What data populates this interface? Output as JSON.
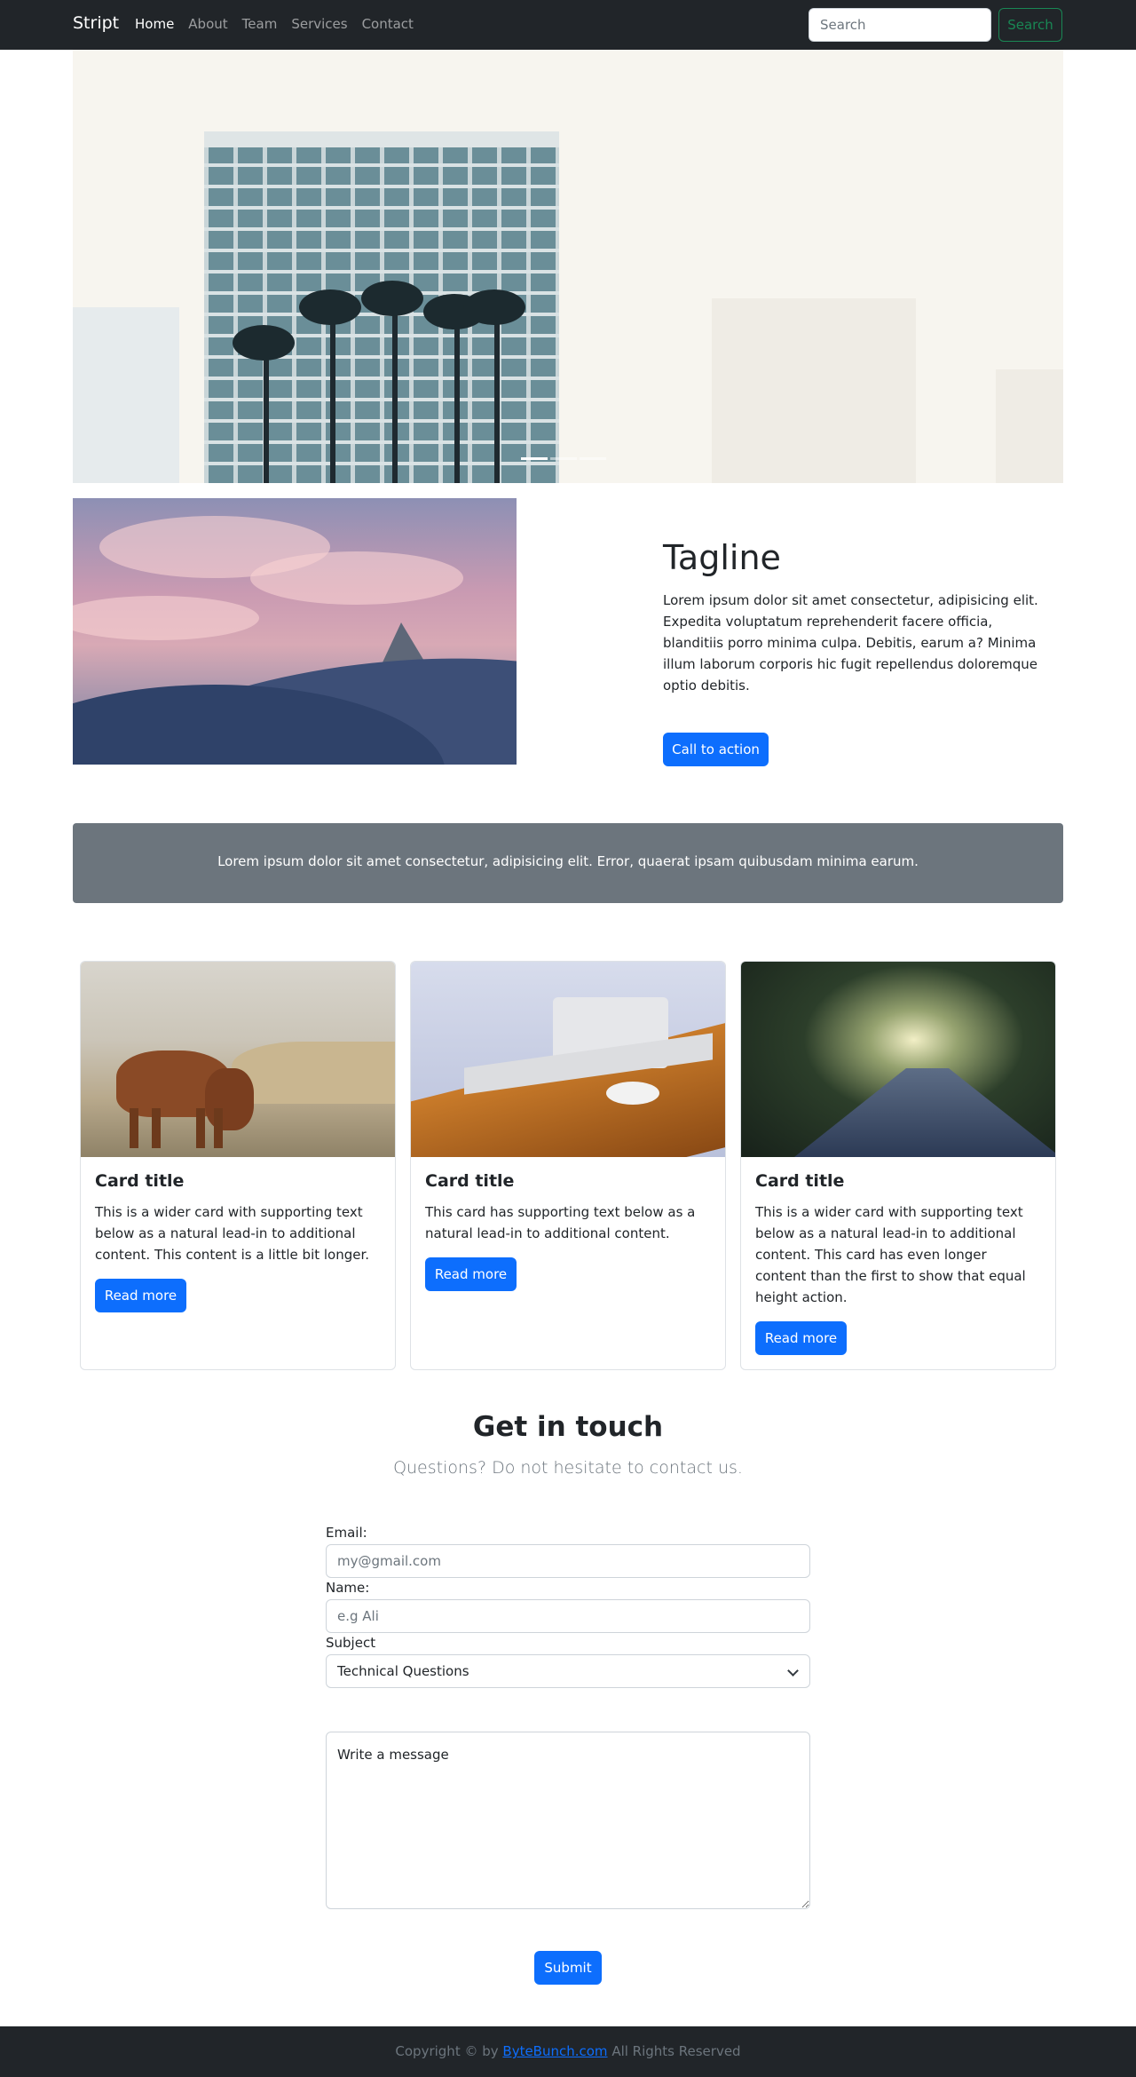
{
  "navbar": {
    "brand": "Stript",
    "links": [
      "Home",
      "About",
      "Team",
      "Services",
      "Contact"
    ],
    "active_link": "Home",
    "search_placeholder": "Search",
    "search_button": "Search"
  },
  "hero": {
    "image": "city-tower-with-palms",
    "indicators": 3,
    "active_indicator": 1
  },
  "feature": {
    "image": "mountain-peak-at-sunset",
    "tagline": "Tagline",
    "text": "Lorem ipsum dolor sit amet consectetur, adipisicing elit. Expedita voluptatum reprehenderit facere officia, blanditiis porro minima culpa. Debitis, earum a? Minima illum laborum corporis hic fugit repellendus doloremque optio debitis.",
    "cta_label": "Call to action"
  },
  "banner": {
    "text": "Lorem ipsum dolor sit amet consectetur, adipisicing elit. Error, quaerat ipsam quibusdam minima earum."
  },
  "cards": [
    {
      "image": "highland-cow",
      "title": "Card title",
      "text": "This is a wider card with supporting text below as a natural lead-in to additional content. This content is a little bit longer.",
      "button": "Read more"
    },
    {
      "image": "laptop-on-desk",
      "title": "Card title",
      "text": "This card has supporting text below as a natural lead-in to additional content.",
      "button": "Read more"
    },
    {
      "image": "tree-lined-road",
      "title": "Card title",
      "text": "This is a wider card with supporting text below as a natural lead-in to additional content. This card has even longer content than the first to show that equal height action.",
      "button": "Read more"
    }
  ],
  "contact": {
    "title": "Get in touch",
    "subtitle": "Questions? Do not hesitate to contact us.",
    "email_label": "Email:",
    "email_placeholder": "my@gmail.com",
    "name_label": "Name:",
    "name_placeholder": "e.g Ali",
    "subject_label": "Subject",
    "subject_value": "Technical Questions",
    "message_placeholder": "Write a message",
    "submit_label": "Submit"
  },
  "footer": {
    "prefix": "Copyright © by ",
    "link": "ByteBunch.com",
    "suffix": " All Rights Reserved"
  },
  "colors": {
    "navbar_bg": "#212529",
    "primary": "#0d6efd",
    "success": "#198754",
    "banner_bg": "#6c757d"
  }
}
